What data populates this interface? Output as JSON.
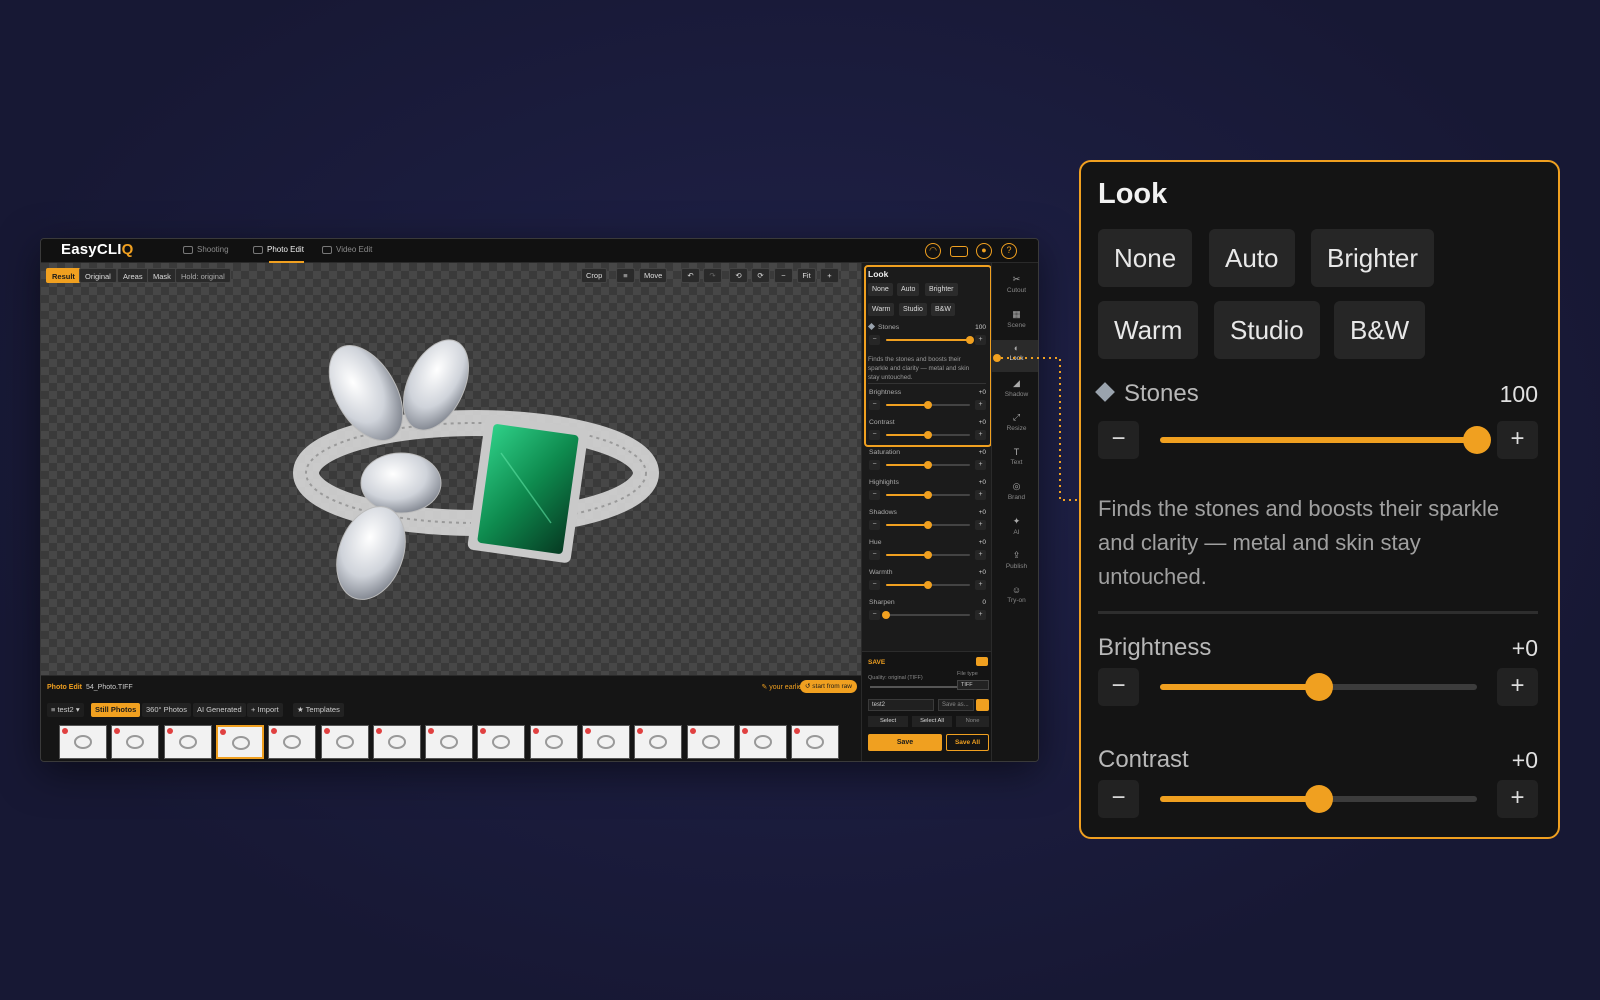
{
  "app": {
    "logo_text": "EasyCLI",
    "logo_accent": "Q",
    "tabs": [
      "Shooting",
      "Photo Edit",
      "Video Edit"
    ],
    "active_tab": "Photo Edit"
  },
  "view": {
    "modes": [
      "Result",
      "Original",
      "Areas",
      "Mask",
      "Hold: original"
    ],
    "active_mode": "Result",
    "tools": {
      "crop": "Crop",
      "move": "Move",
      "fit": "Fit",
      "zoom_in": "+",
      "zoom_out": "−",
      "undo": "↶",
      "redo": "↷"
    }
  },
  "bottom": {
    "section_label": "Photo Edit",
    "filename": "54_Photo.TIFF",
    "earlier_edits": "your earlier edits",
    "start_from_raw": "start from raw",
    "folder": "test2",
    "tabs": [
      "Still Photos",
      "360° Photos",
      "AI Generated",
      "+ Import",
      "★ Templates"
    ],
    "active_tab": "Still Photos"
  },
  "look_panel": {
    "title": "Look",
    "presets": [
      "None",
      "Auto",
      "Brighter",
      "Warm",
      "Studio",
      "B&W"
    ],
    "stones_label": "Stones",
    "stones_value": "100",
    "stones_level": 1.0,
    "description": "Finds the stones and boosts their sparkle and clarity — metal and skin stay untouched.",
    "sliders": [
      {
        "label": "Brightness",
        "value": "+0",
        "level": 0.5
      },
      {
        "label": "Contrast",
        "value": "+0",
        "level": 0.5
      },
      {
        "label": "Saturation",
        "value": "+0",
        "level": 0.5
      },
      {
        "label": "Highlights",
        "value": "+0",
        "level": 0.5
      },
      {
        "label": "Shadows",
        "value": "+0",
        "level": 0.5
      },
      {
        "label": "Hue",
        "value": "+0",
        "level": 0.5
      },
      {
        "label": "Warmth",
        "value": "+0",
        "level": 0.5
      },
      {
        "label": "Sharpen",
        "value": "0",
        "level": 0.0
      }
    ],
    "minus": "−",
    "plus": "+"
  },
  "save": {
    "header": "SAVE",
    "quality": "Quality: original (TIFF)",
    "file_type_label": "File type",
    "file_type": "TIFF",
    "folder": "test2",
    "save_as_placeholder": "Save as...",
    "select": "Select",
    "select_all": "Select All",
    "none": "None",
    "save": "Save",
    "save_all": "Save All"
  },
  "rail": [
    {
      "label": "Cutout",
      "glyph": "✂"
    },
    {
      "label": "Scene",
      "glyph": "▦"
    },
    {
      "label": "Look",
      "glyph": "◐"
    },
    {
      "label": "Shadow",
      "glyph": "◢"
    },
    {
      "label": "Resize",
      "glyph": "⤢"
    },
    {
      "label": "Text",
      "glyph": "T"
    },
    {
      "label": "Brand",
      "glyph": "◎"
    },
    {
      "label": "AI",
      "glyph": "✦"
    },
    {
      "label": "Publish",
      "glyph": "⇪"
    },
    {
      "label": "Try-on",
      "glyph": "☺"
    }
  ],
  "colors": {
    "accent": "#f0a020",
    "background": "#1b1c3a",
    "panel": "#141414"
  }
}
